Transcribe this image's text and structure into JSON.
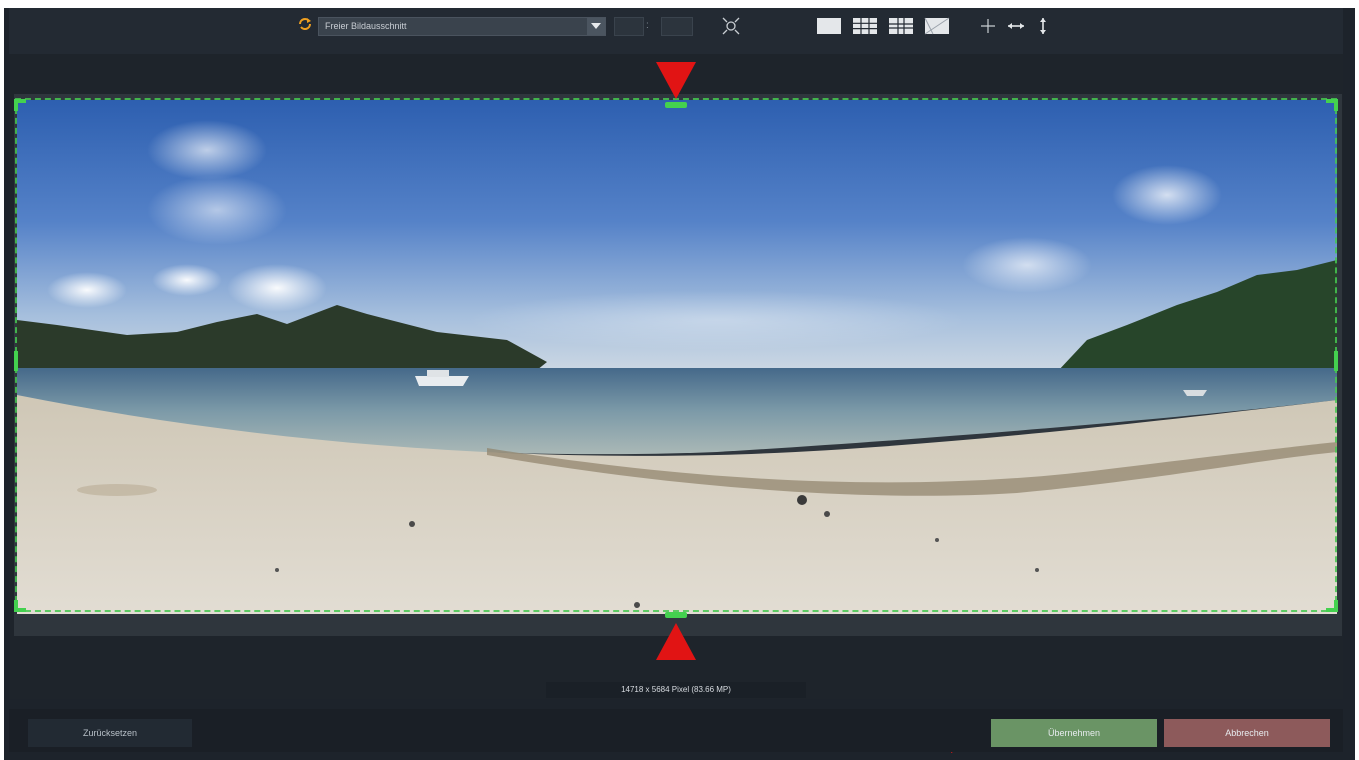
{
  "toolbar": {
    "ratio_select_value": "Freier Bildausschnitt",
    "ratio_separator": ":",
    "icons": [
      "crop-ratio-icon",
      "auto-fit-icon",
      "grid-none-icon",
      "grid-thirds-icon",
      "grid-golden-icon",
      "grid-diagonal-icon",
      "center-icon",
      "flip-horizontal-icon",
      "flip-vertical-icon"
    ]
  },
  "image_info": {
    "size_label": "14718 x 5684 Pixel (83.66 MP)"
  },
  "footer": {
    "reset_label": "Zurücksetzen",
    "apply_label": "Übernehmen",
    "cancel_label": "Abbrechen"
  },
  "colors": {
    "background": "#1d232b",
    "toolbar": "#232a33",
    "crop_handle": "#44d14f",
    "apply_button": "#6a9465",
    "cancel_button": "#8d5a5b",
    "annotation_arrow": "#e11414"
  }
}
